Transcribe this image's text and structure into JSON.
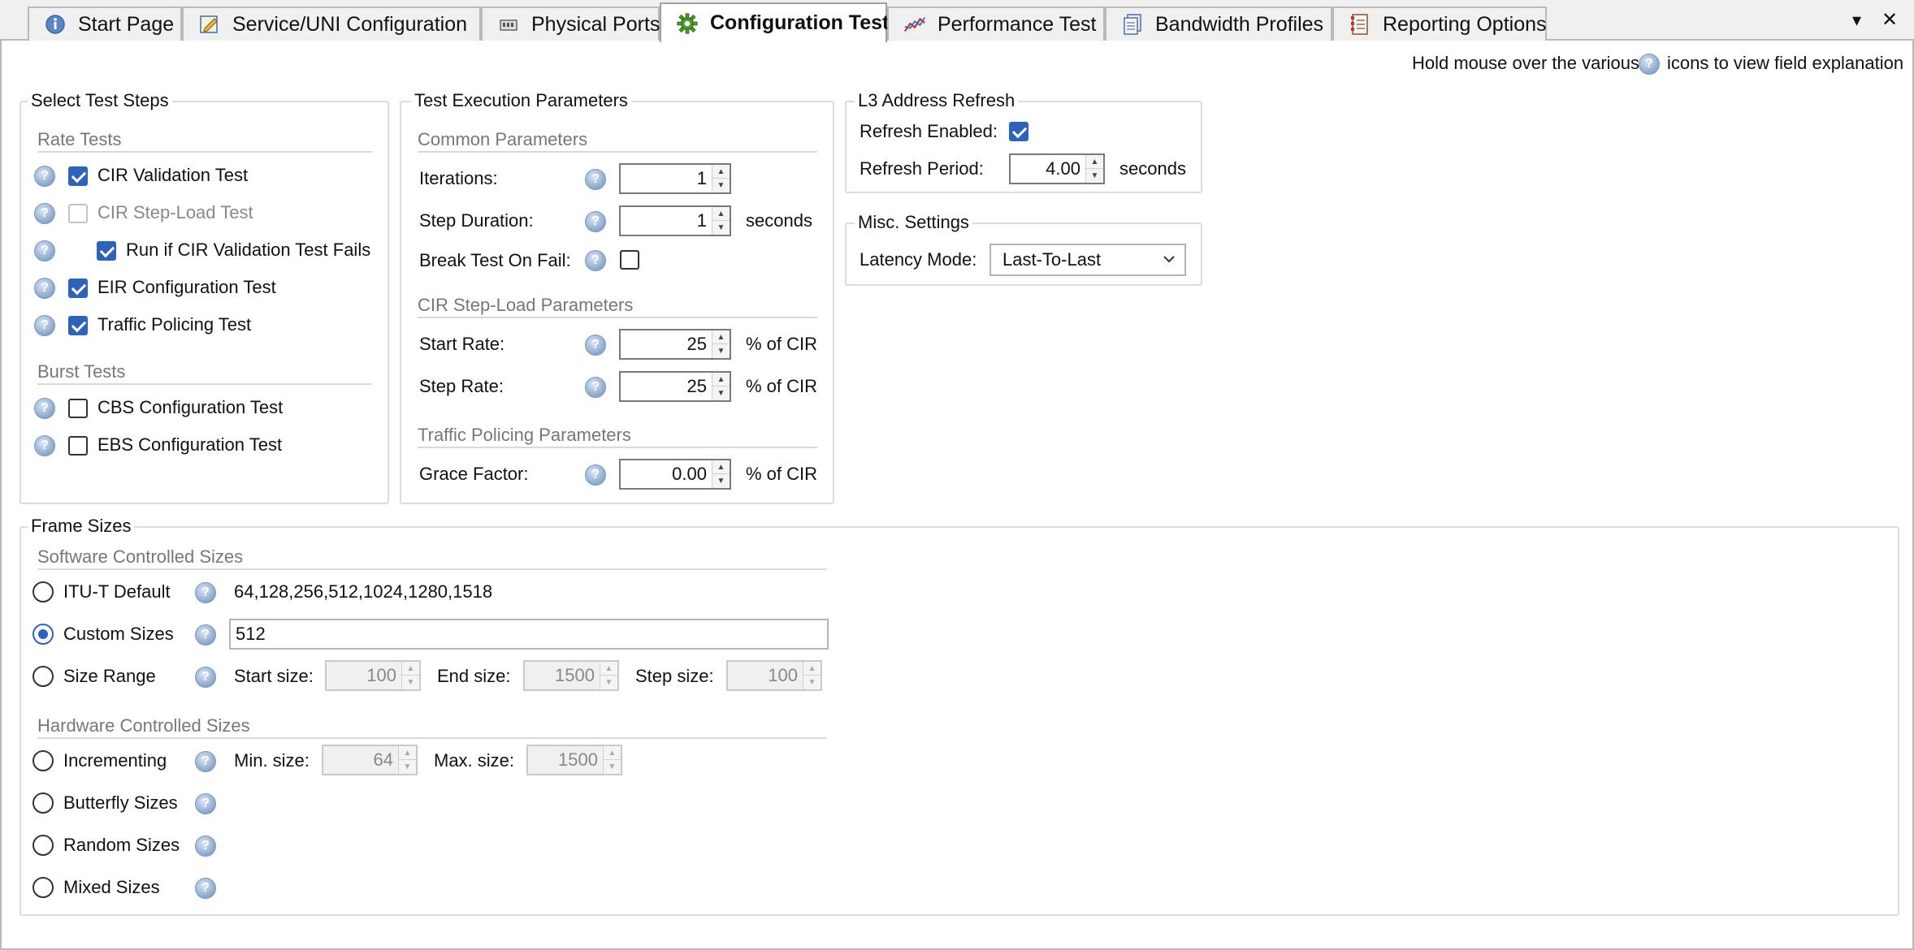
{
  "tabs": [
    {
      "label": "Start Page",
      "icon": "info-icon"
    },
    {
      "label": "Service/UNI Configuration",
      "icon": "edit-icon"
    },
    {
      "label": "Physical Ports",
      "icon": "ports-icon"
    },
    {
      "label": "Configuration Test",
      "icon": "gear-icon",
      "active": true
    },
    {
      "label": "Performance Test",
      "icon": "line-chart-icon"
    },
    {
      "label": "Bandwidth Profiles",
      "icon": "documents-icon"
    },
    {
      "label": "Reporting Options",
      "icon": "report-icon"
    }
  ],
  "window_controls": {
    "dropdown": "▾",
    "close": "✕"
  },
  "hint": {
    "before": "Hold mouse over the various",
    "after": "icons to view field explanation"
  },
  "select_test_steps": {
    "title": "Select Test Steps",
    "rate_tests_head": "Rate Tests",
    "burst_tests_head": "Burst Tests",
    "items": [
      {
        "label": "CIR Validation Test",
        "checked": true
      },
      {
        "label": "CIR Step-Load Test",
        "checked": false,
        "disabled": true
      },
      {
        "label": "Run if CIR Validation Test Fails",
        "checked": true
      },
      {
        "label": "EIR Configuration Test",
        "checked": true
      },
      {
        "label": "Traffic Policing Test",
        "checked": true
      },
      {
        "label": "CBS Configuration Test",
        "checked": false
      },
      {
        "label": "EBS Configuration Test",
        "checked": false
      }
    ]
  },
  "test_execution": {
    "title": "Test Execution Parameters",
    "common_head": "Common Parameters",
    "iterations_label": "Iterations:",
    "iterations_value": "1",
    "step_duration_label": "Step Duration:",
    "step_duration_value": "1",
    "step_duration_unit": "seconds",
    "break_label": "Break Test On Fail:",
    "break_checked": false,
    "step_load_head": "CIR Step-Load Parameters",
    "start_rate_label": "Start Rate:",
    "start_rate_value": "25",
    "start_rate_unit": "% of CIR",
    "step_rate_label": "Step Rate:",
    "step_rate_value": "25",
    "step_rate_unit": "% of CIR",
    "policing_head": "Traffic Policing Parameters",
    "grace_label": "Grace Factor:",
    "grace_value": "0.00",
    "grace_unit": "% of CIR"
  },
  "l3_refresh": {
    "title": "L3 Address Refresh",
    "enabled_label": "Refresh Enabled:",
    "enabled_checked": true,
    "period_label": "Refresh Period:",
    "period_value": "4.00",
    "period_unit": "seconds"
  },
  "misc": {
    "title": "Misc. Settings",
    "latency_label": "Latency Mode:",
    "latency_value": "Last-To-Last"
  },
  "frame_sizes": {
    "title": "Frame Sizes",
    "software_head": "Software Controlled Sizes",
    "itu_label": "ITU-T Default",
    "itu_value": "64,128,256,512,1024,1280,1518",
    "custom_label": "Custom Sizes",
    "custom_value": "512",
    "range_label": "Size Range",
    "start_size_label": "Start size:",
    "start_size_value": "100",
    "end_size_label": "End size:",
    "end_size_value": "1500",
    "step_size_label": "Step size:",
    "step_size_value": "100",
    "hardware_head": "Hardware Controlled Sizes",
    "incrementing_label": "Incrementing",
    "min_size_label": "Min. size:",
    "min_size_value": "64",
    "max_size_label": "Max. size:",
    "max_size_value": "1500",
    "butterfly_label": "Butterfly Sizes",
    "random_label": "Random Sizes",
    "mixed_label": "Mixed Sizes",
    "selected": "Custom Sizes"
  },
  "colors": {
    "accent": "#2f63b8",
    "border": "#dcdcdc",
    "section_text": "#777777"
  }
}
